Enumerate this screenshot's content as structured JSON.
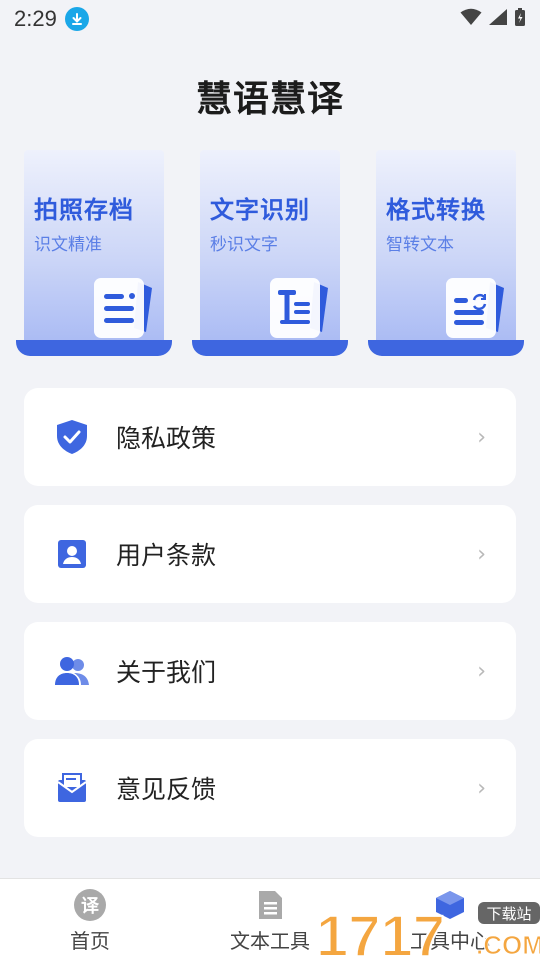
{
  "status_bar": {
    "time": "2:29",
    "icons": [
      "download-icon",
      "wifi-icon",
      "signal-icon",
      "battery-charging-icon"
    ]
  },
  "app": {
    "title": "慧语慧译"
  },
  "features": [
    {
      "name": "拍照存档",
      "subtitle": "识文精准",
      "icon": "document-lines-icon"
    },
    {
      "name": "文字识别",
      "subtitle": "秒识文字",
      "icon": "text-recognize-icon"
    },
    {
      "name": "格式转换",
      "subtitle": "智转文本",
      "icon": "format-convert-icon"
    }
  ],
  "menu": [
    {
      "label": "隐私政策",
      "icon": "shield-check-icon"
    },
    {
      "label": "用户条款",
      "icon": "user-card-icon"
    },
    {
      "label": "关于我们",
      "icon": "users-icon"
    },
    {
      "label": "意见反馈",
      "icon": "mail-feedback-icon"
    }
  ],
  "menu_arrow": "›",
  "bottom_nav": {
    "tabs": [
      {
        "label": "首页",
        "icon": "translate-icon",
        "icon_char": "译"
      },
      {
        "label": "文本工具",
        "icon": "document-icon"
      },
      {
        "label": "工具中心",
        "icon": "toolbox-icon"
      }
    ]
  },
  "watermark": {
    "text": "1717",
    "badge": "下载站",
    "suffix": ".COM"
  },
  "colors": {
    "accent": "#3e66e0",
    "feature_title": "#2f5bdc",
    "background": "#f2f3f7"
  }
}
